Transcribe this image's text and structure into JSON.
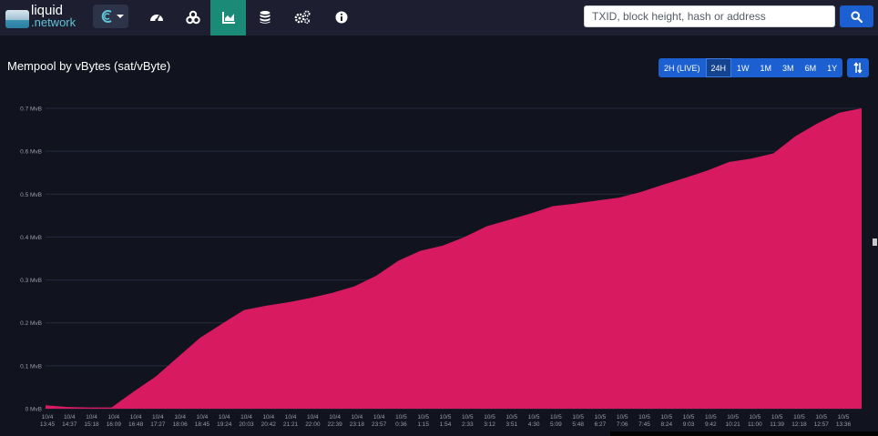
{
  "header": {
    "logo_line1": "liquid",
    "logo_line2": ".network",
    "nav_items": [
      {
        "icon": "dashboard-gauge-icon"
      },
      {
        "icon": "assets-icon"
      },
      {
        "icon": "graphs-icon"
      },
      {
        "icon": "database-icon"
      },
      {
        "icon": "cogs-icon"
      },
      {
        "icon": "info-icon"
      }
    ],
    "search_placeholder": "TXID, block height, hash or address"
  },
  "page": {
    "title": "Mempool by vBytes (sat/vByte)",
    "periods": [
      "2H (LIVE)",
      "24H",
      "1W",
      "1M",
      "3M",
      "6M",
      "1Y"
    ],
    "active_period": "24H"
  },
  "colors": {
    "accent": "#1c5fd1",
    "active_nav": "#1b8a77",
    "series_fill": "#d81b60",
    "background": "#11131f",
    "navbar": "#1d1f31"
  },
  "chart_data": {
    "type": "area",
    "title": "Mempool by vBytes (sat/vByte)",
    "ylim": [
      0,
      0.7
    ],
    "y_ticks": [
      "0 MvB",
      "0.1 MvB",
      "0.2 MvB",
      "0.3 MvB",
      "0.4 MvB",
      "0.5 MvB",
      "0.6 MvB",
      "0.7 MvB"
    ],
    "x_ticks": [
      {
        "date": "10/4",
        "time": "13:45"
      },
      {
        "date": "10/4",
        "time": "14:37"
      },
      {
        "date": "10/4",
        "time": "15:18"
      },
      {
        "date": "10/4",
        "time": "16:09"
      },
      {
        "date": "10/4",
        "time": "16:48"
      },
      {
        "date": "10/4",
        "time": "17:27"
      },
      {
        "date": "10/4",
        "time": "18:06"
      },
      {
        "date": "10/4",
        "time": "18:45"
      },
      {
        "date": "10/4",
        "time": "19:24"
      },
      {
        "date": "10/4",
        "time": "20:03"
      },
      {
        "date": "10/4",
        "time": "20:42"
      },
      {
        "date": "10/4",
        "time": "21:21"
      },
      {
        "date": "10/4",
        "time": "22:00"
      },
      {
        "date": "10/4",
        "time": "22:39"
      },
      {
        "date": "10/4",
        "time": "23:18"
      },
      {
        "date": "10/4",
        "time": "23:57"
      },
      {
        "date": "10/5",
        "time": "0:36"
      },
      {
        "date": "10/5",
        "time": "1:15"
      },
      {
        "date": "10/5",
        "time": "1:54"
      },
      {
        "date": "10/5",
        "time": "2:33"
      },
      {
        "date": "10/5",
        "time": "3:12"
      },
      {
        "date": "10/5",
        "time": "3:51"
      },
      {
        "date": "10/5",
        "time": "4:30"
      },
      {
        "date": "10/5",
        "time": "5:09"
      },
      {
        "date": "10/5",
        "time": "5:48"
      },
      {
        "date": "10/5",
        "time": "6:27"
      },
      {
        "date": "10/5",
        "time": "7:06"
      },
      {
        "date": "10/5",
        "time": "7:45"
      },
      {
        "date": "10/5",
        "time": "8:24"
      },
      {
        "date": "10/5",
        "time": "9:03"
      },
      {
        "date": "10/5",
        "time": "9:42"
      },
      {
        "date": "10/5",
        "time": "10:21"
      },
      {
        "date": "10/5",
        "time": "11:00"
      },
      {
        "date": "10/5",
        "time": "11:39"
      },
      {
        "date": "10/5",
        "time": "12:18"
      },
      {
        "date": "10/5",
        "time": "12:57"
      },
      {
        "date": "10/5",
        "time": "13:36"
      }
    ],
    "series": [
      {
        "values": [
          0.008,
          0.004,
          0.003,
          0.003,
          0.04,
          0.075,
          0.12,
          0.165,
          0.198,
          0.23,
          0.24,
          0.248,
          0.258,
          0.27,
          0.285,
          0.31,
          0.345,
          0.368,
          0.38,
          0.4,
          0.425,
          0.44,
          0.455,
          0.472,
          0.478,
          0.485,
          0.492,
          0.505,
          0.522,
          0.538,
          0.555,
          0.575,
          0.583,
          0.595,
          0.635,
          0.665,
          0.69,
          0.7
        ]
      }
    ],
    "grid": true
  }
}
